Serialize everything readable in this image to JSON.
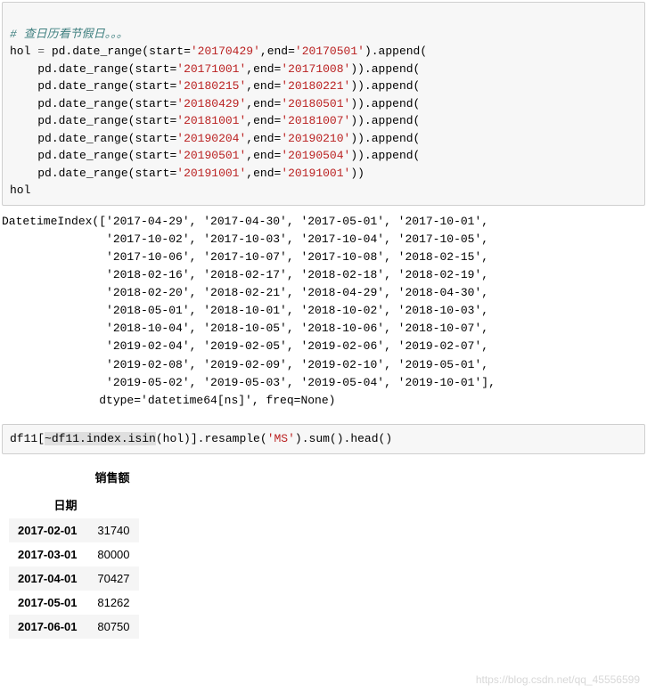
{
  "cell1": {
    "comment": "# 查日历看节假日。。。",
    "l1": {
      "var": "hol ",
      "eq": "= ",
      "pd": "pd.",
      "fn": "date_range",
      "op": "(",
      "a1": "start=",
      "s1": "'20170429'",
      "c": ",",
      "a2": "end=",
      "s2": "'20170501'",
      "cp": ").",
      "ap": "append",
      "end": "("
    },
    "l2": {
      "pad": "    ",
      "pd": "pd.",
      "fn": "date_range",
      "op": "(",
      "a1": "start=",
      "s1": "'20171001'",
      "c": ",",
      "a2": "end=",
      "s2": "'20171008'",
      "cp": ")).",
      "ap": "append",
      "end": "("
    },
    "l3": {
      "pad": "    ",
      "pd": "pd.",
      "fn": "date_range",
      "op": "(",
      "a1": "start=",
      "s1": "'20180215'",
      "c": ",",
      "a2": "end=",
      "s2": "'20180221'",
      "cp": ")).",
      "ap": "append",
      "end": "("
    },
    "l4": {
      "pad": "    ",
      "pd": "pd.",
      "fn": "date_range",
      "op": "(",
      "a1": "start=",
      "s1": "'20180429'",
      "c": ",",
      "a2": "end=",
      "s2": "'20180501'",
      "cp": ")).",
      "ap": "append",
      "end": "("
    },
    "l5": {
      "pad": "    ",
      "pd": "pd.",
      "fn": "date_range",
      "op": "(",
      "a1": "start=",
      "s1": "'20181001'",
      "c": ",",
      "a2": "end=",
      "s2": "'20181007'",
      "cp": ")).",
      "ap": "append",
      "end": "("
    },
    "l6": {
      "pad": "    ",
      "pd": "pd.",
      "fn": "date_range",
      "op": "(",
      "a1": "start=",
      "s1": "'20190204'",
      "c": ",",
      "a2": "end=",
      "s2": "'20190210'",
      "cp": ")).",
      "ap": "append",
      "end": "("
    },
    "l7": {
      "pad": "    ",
      "pd": "pd.",
      "fn": "date_range",
      "op": "(",
      "a1": "start=",
      "s1": "'20190501'",
      "c": ",",
      "a2": "end=",
      "s2": "'20190504'",
      "cp": ")).",
      "ap": "append",
      "end": "("
    },
    "l8": {
      "pad": "    ",
      "pd": "pd.",
      "fn": "date_range",
      "op": "(",
      "a1": "start=",
      "s1": "'20191001'",
      "c": ",",
      "a2": "end=",
      "s2": "'20191001'",
      "cp": "))"
    },
    "last": "hol"
  },
  "out1": {
    "text": "DatetimeIndex(['2017-04-29', '2017-04-30', '2017-05-01', '2017-10-01',\n               '2017-10-02', '2017-10-03', '2017-10-04', '2017-10-05',\n               '2017-10-06', '2017-10-07', '2017-10-08', '2018-02-15',\n               '2018-02-16', '2018-02-17', '2018-02-18', '2018-02-19',\n               '2018-02-20', '2018-02-21', '2018-04-29', '2018-04-30',\n               '2018-05-01', '2018-10-01', '2018-10-02', '2018-10-03',\n               '2018-10-04', '2018-10-05', '2018-10-06', '2018-10-07',\n               '2019-02-04', '2019-02-05', '2019-02-06', '2019-02-07',\n               '2019-02-08', '2019-02-09', '2019-02-10', '2019-05-01',\n               '2019-05-02', '2019-05-03', '2019-05-04', '2019-10-01'],\n              dtype='datetime64[ns]', freq=None)"
  },
  "cell2": {
    "p1": "df11[",
    "hl": "~df11.index.isin",
    "p2": "(hol)].",
    "fn1": "resample",
    "p3": "(",
    "str": "'MS'",
    "p4": ").",
    "fn2": "sum",
    "p5": "().",
    "fn3": "head",
    "p6": "()"
  },
  "table": {
    "col": "销售额",
    "idx": "日期",
    "rows": [
      {
        "d": "2017-02-01",
        "v": "31740"
      },
      {
        "d": "2017-03-01",
        "v": "80000"
      },
      {
        "d": "2017-04-01",
        "v": "70427"
      },
      {
        "d": "2017-05-01",
        "v": "81262"
      },
      {
        "d": "2017-06-01",
        "v": "80750"
      }
    ]
  },
  "watermark": "https://blog.csdn.net/qq_45556599"
}
